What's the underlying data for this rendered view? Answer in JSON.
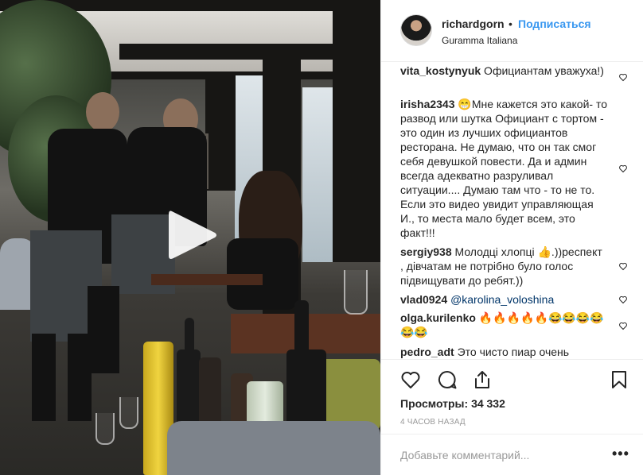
{
  "media": {
    "play_icon": "play-icon"
  },
  "header": {
    "username": "richardgorn",
    "dot": "•",
    "follow_label": "Подписаться",
    "location": "Guramma Italiana"
  },
  "comments": [
    {
      "user": "vita_kostynyuk",
      "text": " Официантам уважуха!)"
    },
    {
      "user": "irisha2343",
      "text": " 😁Мне кажется это какой- то развод или шутка Официант с тортом - это один из лучших официантов ресторана. Не думаю, что он так смог себя девушкой повести. Да и админ всегда адекватно разруливал ситуации.... Думаю там что - то не то. Если это видео увидит управляющая И., то места мало будет всем, это факт!!!"
    },
    {
      "user": "sergiy938",
      "text": " Молодці хлопці 👍.))респект , дівчатам не потрібно було голос підвищувати до ребят.))"
    },
    {
      "user": "vlad0924",
      "mention": "@karolina_voloshina"
    },
    {
      "user": "olga.kurilenko",
      "text": " 🔥🔥🔥🔥🔥😂😂😂😂😂😂"
    },
    {
      "user": "pedro_adt",
      "text": " Это чисто пиар очень"
    }
  ],
  "actions": {
    "like_icon": "heart-icon",
    "comment_icon": "comment-icon",
    "share_icon": "share-icon",
    "save_icon": "bookmark-icon"
  },
  "stats": {
    "views_label": "Просмотры:",
    "views_count": "34 332",
    "time": "4 ЧАСОВ НАЗАД"
  },
  "add_comment": {
    "placeholder": "Добавьте комментарий...",
    "more_label": "•••"
  }
}
